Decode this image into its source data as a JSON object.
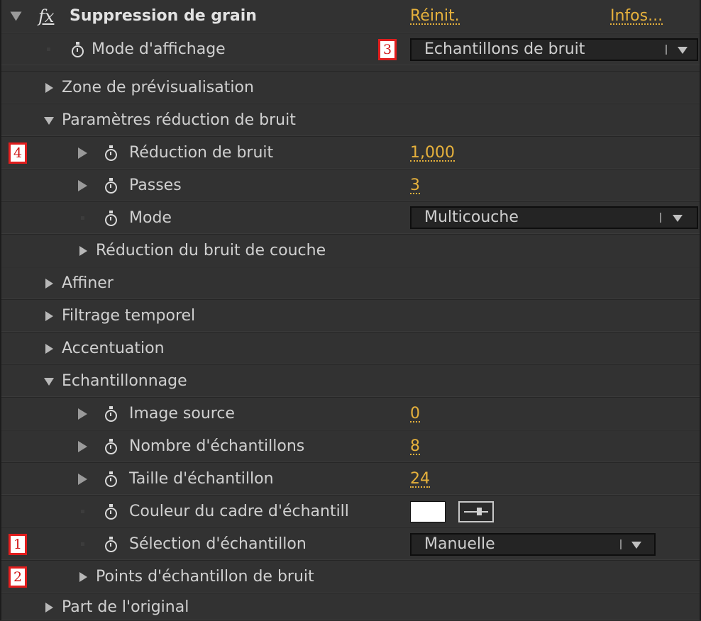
{
  "effect": {
    "title": "Suppression de grain",
    "reset_label": "Réinit.",
    "about_label": "Infos..."
  },
  "rows": {
    "display_mode": {
      "label": "Mode d'affichage",
      "value": "Echantillons de bruit"
    },
    "preview_region": {
      "label": "Zone de prévisualisation"
    },
    "noise_reduction_settings": {
      "label": "Paramètres réduction de bruit"
    },
    "noise_reduction": {
      "label": "Réduction de bruit",
      "value": "1,000"
    },
    "passes": {
      "label": "Passes",
      "value": "3"
    },
    "mode": {
      "label": "Mode",
      "value": "Multicouche"
    },
    "channel_noise_reduction": {
      "label": "Réduction du bruit de couche"
    },
    "refine": {
      "label": "Affiner"
    },
    "temporal_filtering": {
      "label": "Filtrage temporel"
    },
    "sharpening": {
      "label": "Accentuation"
    },
    "sampling": {
      "label": "Echantillonnage"
    },
    "source_frame": {
      "label": "Image source",
      "value": "0"
    },
    "num_samples": {
      "label": "Nombre d'échantillons",
      "value": "8"
    },
    "sample_size": {
      "label": "Taille d'échantillon",
      "value": "24"
    },
    "sample_box_color": {
      "label": "Couleur du cadre d'échantill",
      "color": "#ffffff"
    },
    "sample_selection": {
      "label": "Sélection d'échantillon",
      "value": "Manuelle"
    },
    "noise_sample_points": {
      "label": "Points d'échantillon de bruit"
    },
    "blend_with_original": {
      "label": "Part de l'original"
    }
  },
  "markers": [
    "1",
    "2",
    "3",
    "4"
  ],
  "colors": {
    "panel_bg": "#323232",
    "value_accent": "#e6b13c",
    "marker_border": "#e11d1d"
  }
}
